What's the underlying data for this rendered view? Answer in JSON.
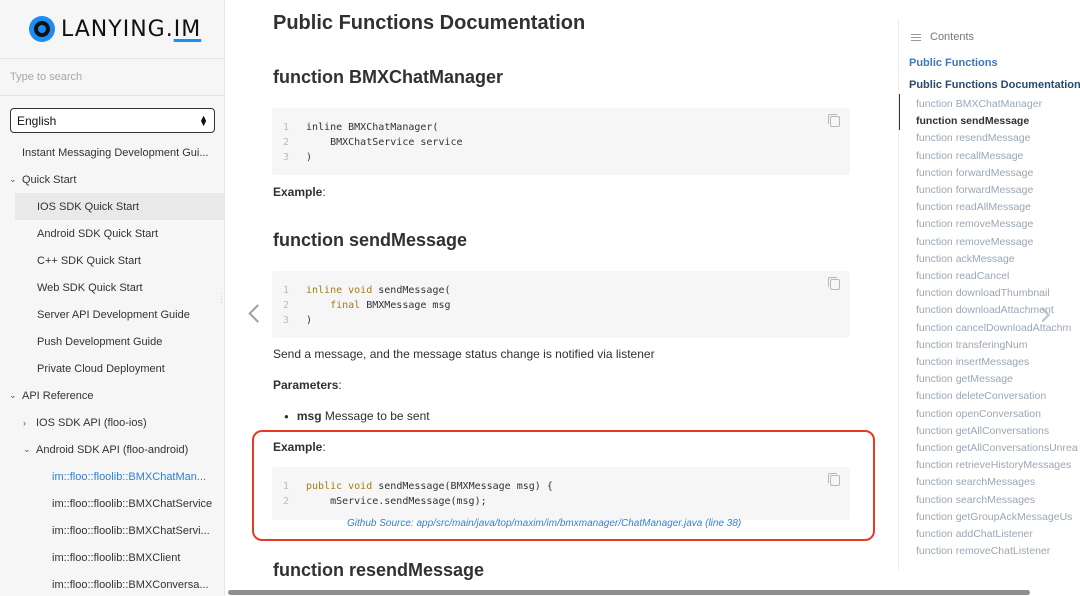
{
  "logo": {
    "name": "LANYING.",
    "suffix": "IM"
  },
  "search": {
    "placeholder": "Type to search"
  },
  "language": {
    "selected": "English"
  },
  "nav": [
    {
      "label": "Instant Messaging Development Gui...",
      "level": 0
    },
    {
      "label": "Quick Start",
      "level": 0,
      "expanded": true
    },
    {
      "label": "IOS SDK Quick Start",
      "level": 1,
      "active": true
    },
    {
      "label": "Android SDK Quick Start",
      "level": 1
    },
    {
      "label": "C++ SDK Quick Start",
      "level": 1
    },
    {
      "label": "Web SDK Quick Start",
      "level": 1
    },
    {
      "label": "Server API Development Guide",
      "level": 1
    },
    {
      "label": "Push Development Guide",
      "level": 1
    },
    {
      "label": "Private Cloud Deployment",
      "level": 1
    },
    {
      "label": "API Reference",
      "level": 0,
      "expanded": true
    },
    {
      "label": "IOS SDK API (floo-ios)",
      "level": 1,
      "expanded": false
    },
    {
      "label": "Android SDK API (floo-android)",
      "level": 1,
      "expanded": true
    },
    {
      "label": "im::floo::floolib::BMXChatMan...",
      "level": 2,
      "current": true
    },
    {
      "label": "im::floo::floolib::BMXChatService",
      "level": 2
    },
    {
      "label": "im::floo::floolib::BMXChatServi...",
      "level": 2
    },
    {
      "label": "im::floo::floolib::BMXClient",
      "level": 2
    },
    {
      "label": "im::floo::floolib::BMXConversa...",
      "level": 2
    }
  ],
  "main": {
    "title": "Public Functions Documentation",
    "sections": {
      "bmxchatmanager": {
        "heading": "function BMXChatManager",
        "code": [
          {
            "n": "1",
            "text": "inline BMXChatManager("
          },
          {
            "n": "2",
            "text": "    BMXChatService service"
          },
          {
            "n": "3",
            "text": ")"
          }
        ],
        "example_label": "Example",
        "example_colon": ":"
      },
      "sendmessage": {
        "heading": "function sendMessage",
        "code": [
          {
            "n": "1",
            "kw": "inline void",
            "text": " sendMessage("
          },
          {
            "n": "2",
            "kw": "    final",
            "text": " BMXMessage msg"
          },
          {
            "n": "3",
            "text": ")"
          }
        ],
        "description": "Send a message, and the message status change is notified via listener",
        "params_label": "Parameters",
        "params_colon": ":",
        "param_name": "msg",
        "param_desc": " Message to be sent",
        "example_label": "Example",
        "example_colon": ":",
        "example_code": [
          {
            "n": "1",
            "kw": "public void",
            "text": " sendMessage(BMXMessage msg) {"
          },
          {
            "n": "2",
            "text": "    mService.sendMessage(msg);"
          }
        ],
        "github_link": "Github Source: app/src/main/java/top/maxim/im/bmxmanager/ChatManager.java (line 38)"
      },
      "resendmessage": {
        "heading": "function resendMessage"
      }
    }
  },
  "toc": {
    "header": "Contents",
    "section1": "Public Functions",
    "section2": "Public Functions Documentation",
    "items": [
      "function BMXChatManager",
      "function sendMessage",
      "function resendMessage",
      "function recallMessage",
      "function forwardMessage",
      "function forwardMessage",
      "function readAllMessage",
      "function removeMessage",
      "function removeMessage",
      "function ackMessage",
      "function readCancel",
      "function downloadThumbnail",
      "function downloadAttachment",
      "function cancelDownloadAttachm",
      "function transferingNum",
      "function insertMessages",
      "function getMessage",
      "function deleteConversation",
      "function openConversation",
      "function getAllConversations",
      "function getAllConversationsUnrea",
      "function retrieveHistoryMessages",
      "function searchMessages",
      "function searchMessages",
      "function getGroupAckMessageUs",
      "function addChatListener",
      "function removeChatListener"
    ],
    "active_index": 1
  },
  "colors": {
    "accent": "#2f7fd4",
    "highlight": "#e53a23",
    "brand": "#1b8df5"
  },
  "icons": [
    "search-icon",
    "select-arrows-icon",
    "chevron-down-icon",
    "chevron-right-icon",
    "copy-icon",
    "arrow-left-icon",
    "arrow-right-icon",
    "toc-list-icon"
  ]
}
